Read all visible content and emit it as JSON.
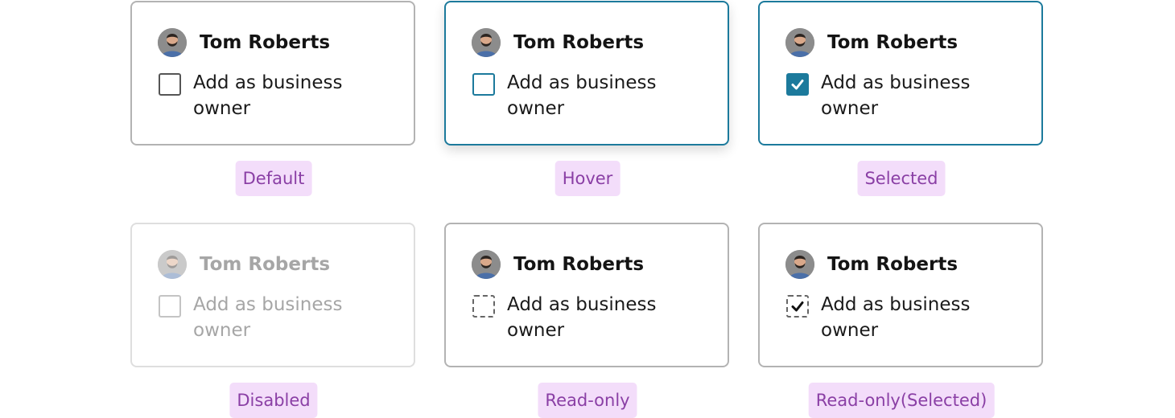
{
  "cards": [
    {
      "state": "default",
      "name": "Tom Roberts",
      "checkbox_label": "Add as business owner",
      "checked": false,
      "caption": "Default"
    },
    {
      "state": "hover",
      "name": "Tom Roberts",
      "checkbox_label": "Add as business owner",
      "checked": false,
      "caption": "Hover"
    },
    {
      "state": "selected",
      "name": "Tom Roberts",
      "checkbox_label": "Add as business owner",
      "checked": true,
      "caption": "Selected"
    },
    {
      "state": "disabled",
      "name": "Tom Roberts",
      "checkbox_label": "Add as business owner",
      "checked": false,
      "caption": "Disabled"
    },
    {
      "state": "read-only",
      "name": "Tom Roberts",
      "checkbox_label": "Add as business owner",
      "checked": false,
      "caption": "Read-only"
    },
    {
      "state": "read-only-selected",
      "name": "Tom Roberts",
      "checkbox_label": "Add as business owner",
      "checked": true,
      "caption": "Read-only(Selected)"
    }
  ],
  "colors": {
    "accent": "#1c7a9c",
    "caption_background": "#f3ddfa",
    "caption_text": "#8a3fa5",
    "border_default": "#b3b3b3",
    "border_disabled": "#dedede"
  },
  "icons": {
    "avatar": "avatar-photo",
    "checked_mark": "check-icon"
  }
}
